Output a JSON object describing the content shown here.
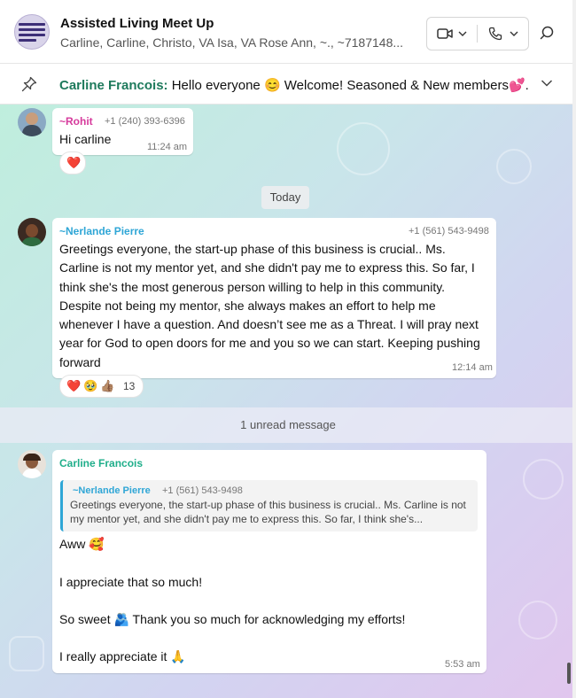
{
  "header": {
    "title": "Assisted Living Meet Up",
    "members": "Carline, Carline, Christo, VA Isa, VA Rose Ann, ~., ~7187148..."
  },
  "pinned": {
    "sender": "Carline Francois:",
    "text": "Hello everyone 😊  Welcome! Seasoned & New members💕..."
  },
  "messages": [
    {
      "sender": "~Rohit",
      "phone": "+1 (240) 393-6396",
      "text": "Hi carline",
      "time": "11:24 am",
      "reactions": [
        "❤️"
      ]
    },
    {
      "sender": "~Nerlande Pierre",
      "phone": "+1 (561) 543-9498",
      "text": "Greetings everyone, the start-up phase of this business is crucial.. Ms. Carline is not my mentor yet, and she didn't pay me to express this. So far, I think she's the most generous person willing to help in this community. Despite not being my mentor, she always makes an effort to help me whenever I have a question. And doesn’t see me as a Threat. I will pray next year for God to open doors for me and you so we can start. Keeping pushing forward",
      "time": "12:14 am",
      "reactions": [
        "❤️",
        "🥹",
        "👍🏽"
      ],
      "reaction_count": "13"
    },
    {
      "sender": "Carline Francois",
      "quote": {
        "sender": "~Nerlande Pierre",
        "phone": "+1 (561) 543-9498",
        "text": "Greetings everyone, the start-up phase of this business is crucial.. Ms. Carline is not my mentor yet, and she didn't pay me to express this. So far, I think she's..."
      },
      "lines": [
        "Aww 🥰",
        "I appreciate that so much!",
        "So sweet 🫂 Thank you so much for acknowledging my efforts!",
        "I really appreciate it 🙏"
      ],
      "time": "5:53 am"
    }
  ],
  "date_divider": "Today",
  "unread_divider": "1 unread message",
  "colors": {
    "rohit": "#d63a9c",
    "nerlande": "#2fa6d6",
    "carline": "#1fae8a",
    "pinned_sender": "#1e7a5c"
  }
}
